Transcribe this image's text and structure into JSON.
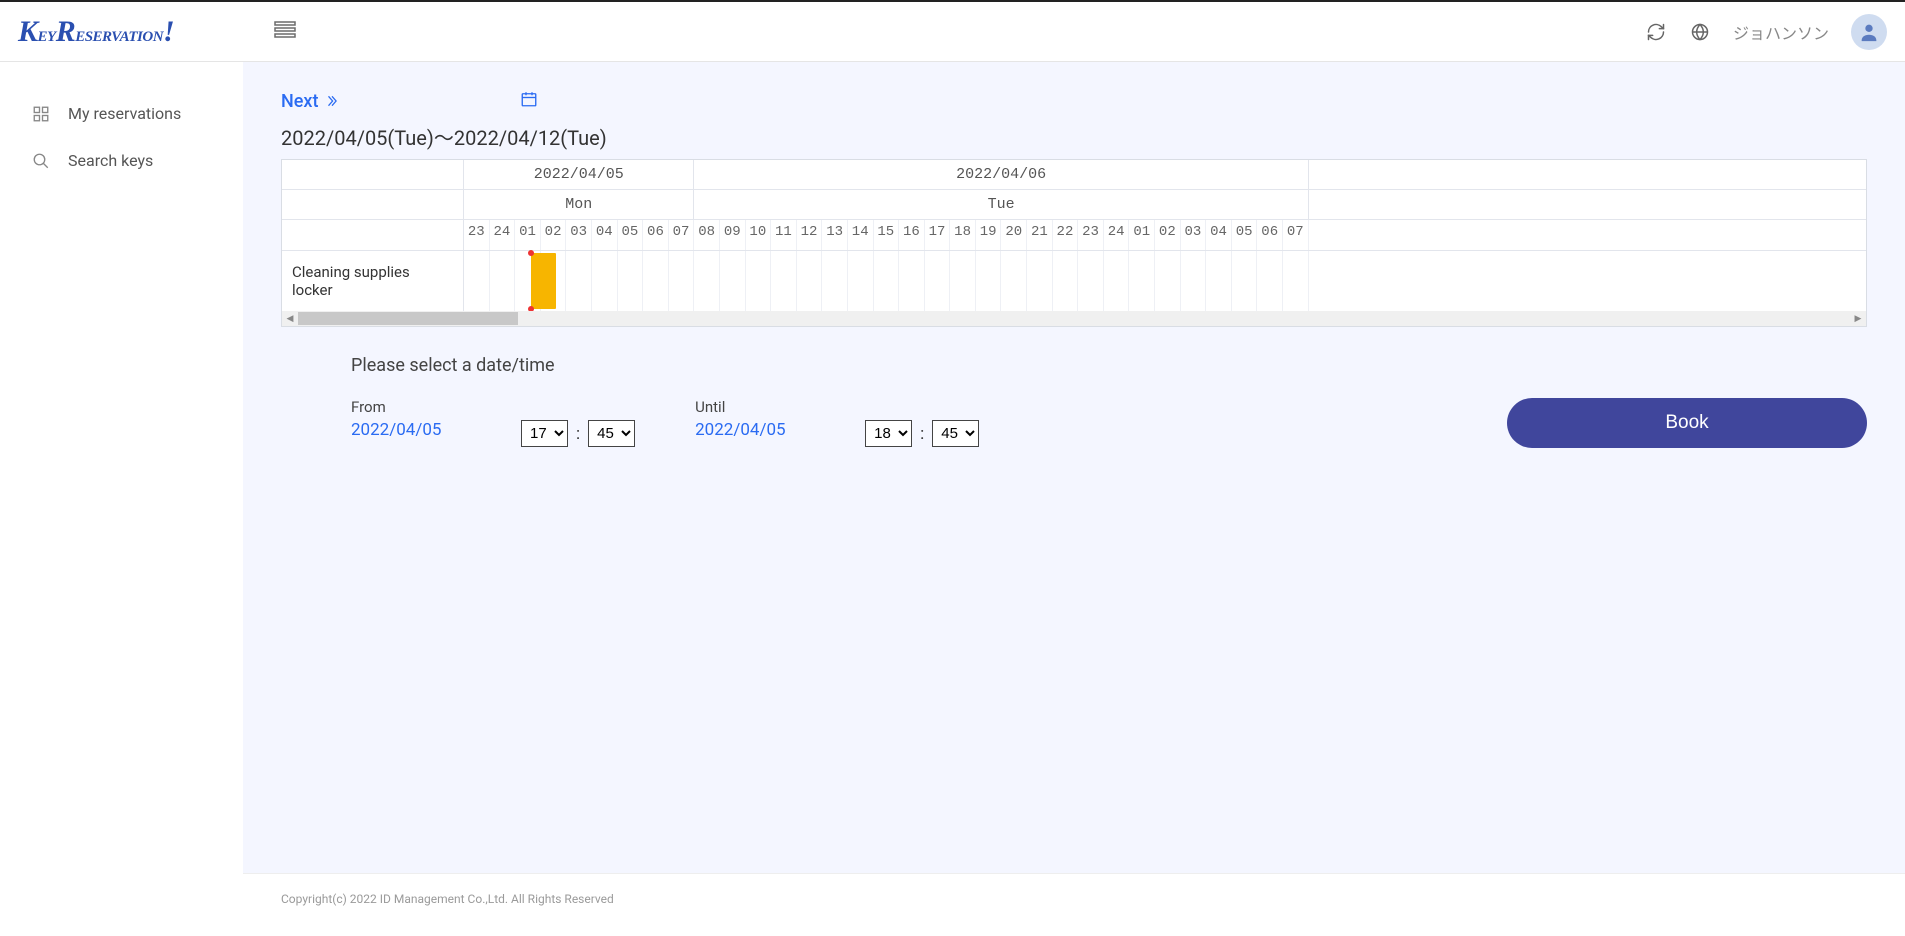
{
  "brand": {
    "text": "KeyReservation!"
  },
  "user": {
    "name": "ジョハンソン"
  },
  "sidebar": {
    "items": [
      {
        "label": "My reservations"
      },
      {
        "label": "Search keys"
      }
    ]
  },
  "toolbar": {
    "next_label": "Next",
    "date_range": "2022/04/05(Tue)～2022/04/12(Tue)"
  },
  "schedule": {
    "days": [
      {
        "date": "2022/04/05",
        "dow": "Mon",
        "hour_span": 9
      },
      {
        "date": "2022/04/06",
        "dow": "Tue",
        "hour_span": 24
      }
    ],
    "hours": [
      "23",
      "24",
      "01",
      "02",
      "03",
      "04",
      "05",
      "06",
      "07",
      "08",
      "09",
      "10",
      "11",
      "12",
      "13",
      "14",
      "15",
      "16",
      "17",
      "18",
      "19",
      "20",
      "21",
      "22",
      "23",
      "24",
      "01",
      "02",
      "03",
      "04",
      "05",
      "06",
      "07"
    ],
    "rows": [
      {
        "label": "Cleaning supplies locker",
        "booking": {
          "start_index": 2.6,
          "span": 1
        }
      }
    ]
  },
  "form": {
    "title": "Please select a date/time",
    "from_label": "From",
    "from_date": "2022/04/05",
    "from_hour": "17",
    "from_min": "45",
    "until_label": "Until",
    "until_date": "2022/04/05",
    "until_hour": "18",
    "until_min": "45",
    "book_label": "Book"
  },
  "footer": {
    "copyright": "Copyright(c) 2022 ID Management Co.,Ltd. All Rights Reserved"
  }
}
